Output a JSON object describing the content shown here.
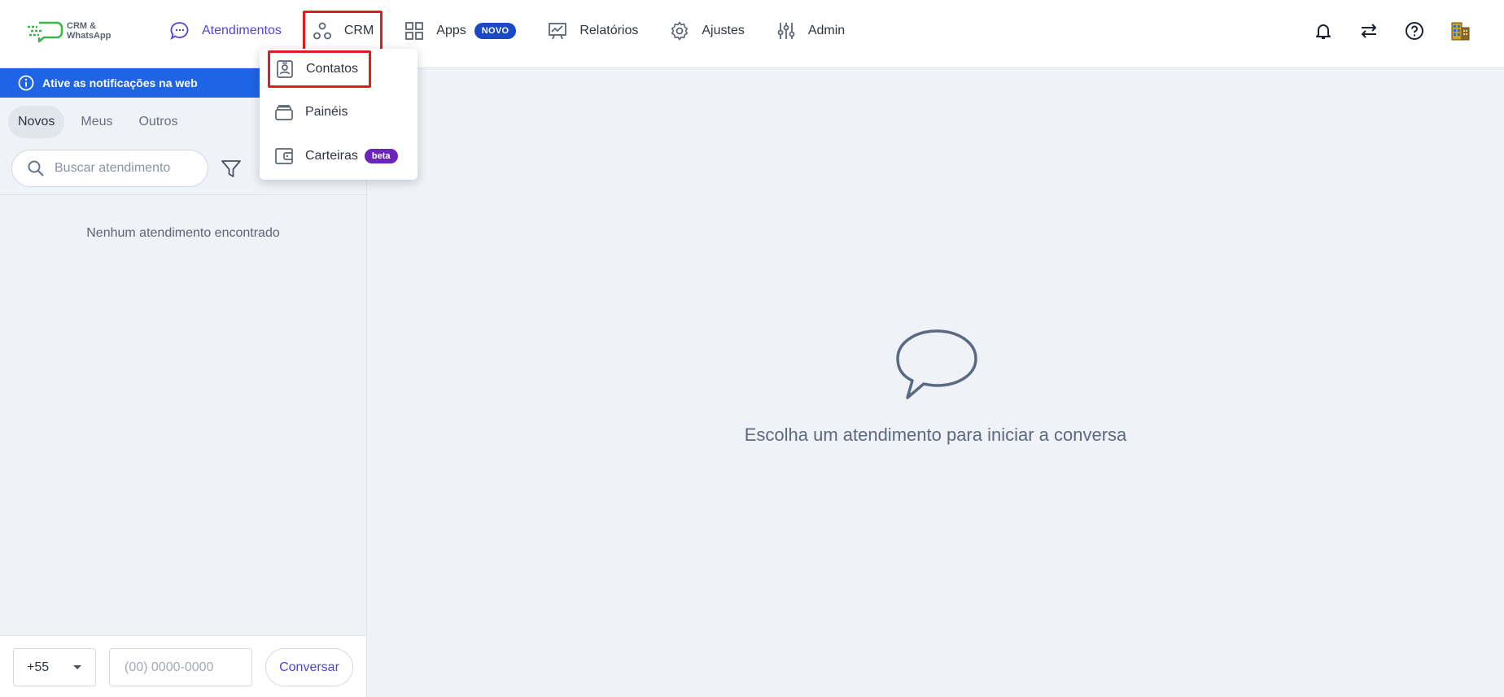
{
  "brand": {
    "line1": "CRM &",
    "line2": "WhatsApp"
  },
  "nav": {
    "atendimentos": "Atendimentos",
    "crm": "CRM",
    "apps": "Apps",
    "apps_badge": "NOVO",
    "relatorios": "Relatórios",
    "ajustes": "Ajustes",
    "admin": "Admin"
  },
  "crm_menu": {
    "contatos": "Contatos",
    "paineis": "Painéis",
    "carteiras": "Carteiras",
    "carteiras_badge": "beta"
  },
  "sidebar": {
    "notice": "Ative as notificações na web",
    "tabs": [
      "Novos",
      "Meus",
      "Outros"
    ],
    "search_placeholder": "Buscar atendimento",
    "empty": "Nenhum atendimento encontrado",
    "ddi": "+55",
    "phone_placeholder": "(00) 0000-0000",
    "conversar": "Conversar"
  },
  "main": {
    "empty": "Escolha um atendimento para iniciar a conversa"
  },
  "colors": {
    "accent": "#5145d6",
    "notice_bg": "#1f63e6",
    "highlight": "#e31b1b",
    "novo": "#1d48c3",
    "beta": "#6b25b8"
  }
}
